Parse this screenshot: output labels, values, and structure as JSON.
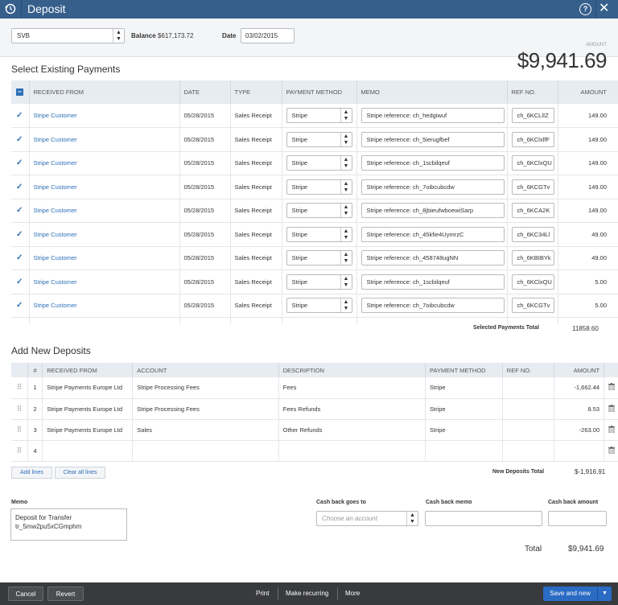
{
  "title": "Deposit",
  "account": {
    "value": "SVB",
    "balance_label": "Balance",
    "balance": "$617,173.72"
  },
  "date": {
    "label": "Date",
    "value": "03/02/2015"
  },
  "amount": {
    "label": "AMOUNT",
    "value": "$9,941.69"
  },
  "existing": {
    "heading": "Select Existing Payments",
    "columns": [
      "RECEIVED FROM",
      "DATE",
      "TYPE",
      "PAYMENT METHOD",
      "MEMO",
      "REF NO.",
      "AMOUNT"
    ],
    "rows": [
      {
        "from": "Stripe Customer",
        "date": "05/28/2015",
        "type": "Sales Receipt",
        "method": "Stripe",
        "memo": "Stripe reference: ch_hedgiwuf",
        "ref": "ch_6KCLlIZ",
        "amount": "149.00"
      },
      {
        "from": "Stripe Customer",
        "date": "05/28/2015",
        "type": "Sales Receipt",
        "method": "Stripe",
        "memo": "Stripe reference: ch_5ierugfbef",
        "ref": "ch_6KClxlfF",
        "amount": "149.00"
      },
      {
        "from": "Stripe Customer",
        "date": "05/28/2015",
        "type": "Sales Receipt",
        "method": "Stripe",
        "memo": "Stripe reference: ch_1scbilqeuf",
        "ref": "ch_6KClxQU",
        "amount": "149.00"
      },
      {
        "from": "Stripe Customer",
        "date": "05/28/2015",
        "type": "Sales Receipt",
        "method": "Stripe",
        "memo": "Stripe reference: ch_7oibcubcdw",
        "ref": "ch_6KCGTv",
        "amount": "149.00"
      },
      {
        "from": "Stripe Customer",
        "date": "05/28/2015",
        "type": "Sales Receipt",
        "method": "Stripe",
        "memo": "Stripe reference: ch_8jbieufwboewiSarp",
        "ref": "ch_6KCA2K",
        "amount": "149.00"
      },
      {
        "from": "Stripe Customer",
        "date": "05/28/2015",
        "type": "Sales Receipt",
        "method": "Stripe",
        "memo": "Stripe reference: ch_45kfie4UymrzC",
        "ref": "ch_6KC34Ll",
        "amount": "49.00"
      },
      {
        "from": "Stripe Customer",
        "date": "05/28/2015",
        "type": "Sales Receipt",
        "method": "Stripe",
        "memo": "Stripe reference: ch_458748ugNN",
        "ref": "ch_6KBIBYk",
        "amount": "49.00"
      },
      {
        "from": "Stripe Customer",
        "date": "05/28/2015",
        "type": "Sales Receipt",
        "method": "Stripe",
        "memo": "Stripe reference: ch_1scbilqeuf",
        "ref": "ch_6KClxQU",
        "amount": "5.00"
      },
      {
        "from": "Stripe Customer",
        "date": "05/28/2015",
        "type": "Sales Receipt",
        "method": "Stripe",
        "memo": "Stripe reference: ch_7oibcubcdw",
        "ref": "ch_6KCGTv",
        "amount": "5.00"
      }
    ],
    "total_label": "Selected Payments Total",
    "total": "11858.60"
  },
  "new_deposits": {
    "heading": "Add New Deposits",
    "columns": [
      "#",
      "RECEIVED FROM",
      "ACCOUNT",
      "DESCRIPTION",
      "PAYMENT METHOD",
      "REF NO.",
      "AMOUNT"
    ],
    "rows": [
      {
        "n": "1",
        "from": "Stripe Payments Europe Ltd",
        "account": "Stripe Processing Fees",
        "desc": "Fees",
        "method": "Stripe",
        "ref": "",
        "amount": "-1,662.44"
      },
      {
        "n": "2",
        "from": "Stripe Payments Europe Ltd",
        "account": "Stripe Processing Fees",
        "desc": "Fees Refunds",
        "method": "Stripe",
        "ref": "",
        "amount": "8.53"
      },
      {
        "n": "3",
        "from": "Stripe Payments Europe Ltd",
        "account": "Sales",
        "desc": "Other Refunds",
        "method": "Stripe",
        "ref": "",
        "amount": "-263.00"
      },
      {
        "n": "4",
        "from": "",
        "account": "",
        "desc": "",
        "method": "",
        "ref": "",
        "amount": ""
      }
    ],
    "add_lines": "Add lines",
    "clear_lines": "Clear all lines",
    "total_label": "New Deposits Total",
    "total": "$-1,916.91"
  },
  "memo": {
    "label": "Memo",
    "line1": "Deposit for Transfer",
    "line2": "tr_5mw2pu5xCGmphm"
  },
  "cashback": {
    "goes_to_label": "Cash back goes to",
    "goes_to_placeholder": "Choose an account",
    "memo_label": "Cash back memo",
    "amount_label": "Cash back amount"
  },
  "total": {
    "label": "Total",
    "value": "$9,941.69"
  },
  "footer": {
    "cancel": "Cancel",
    "revert": "Revert",
    "print": "Print",
    "recurring": "Make recurring",
    "more": "More",
    "save": "Save and new"
  }
}
